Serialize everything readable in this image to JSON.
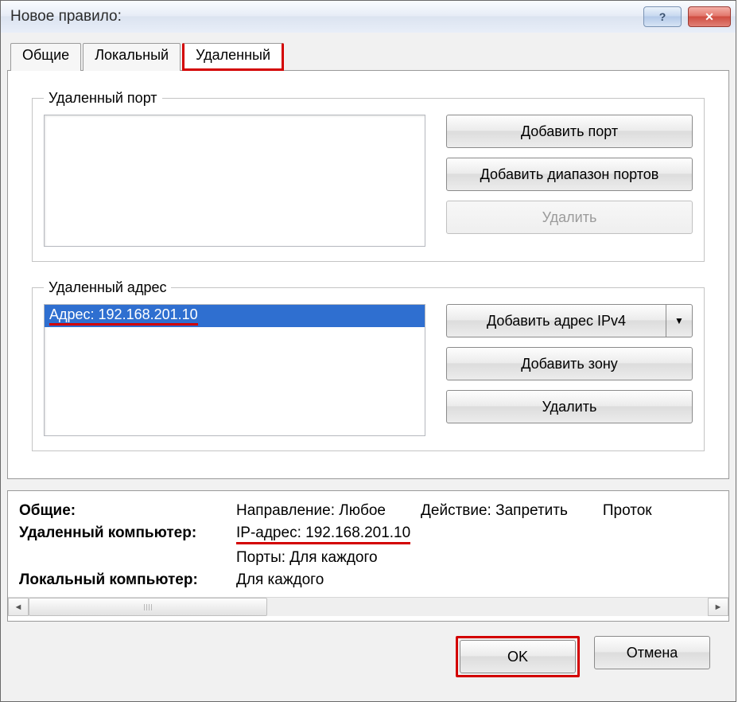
{
  "window": {
    "title": "Новое правило:"
  },
  "tabs": {
    "general": "Общие",
    "local": "Локальный",
    "remote": "Удаленный"
  },
  "remote_port": {
    "legend": "Удаленный порт",
    "add_port": "Добавить порт",
    "add_range": "Добавить диапазон портов",
    "delete": "Удалить"
  },
  "remote_addr": {
    "legend": "Удаленный адрес",
    "items": [
      "Адрес: 192.168.201.10"
    ],
    "add_ipv4": "Добавить адрес IPv4",
    "add_zone": "Добавить зону",
    "delete": "Удалить"
  },
  "summary": {
    "general_label": "Общие:",
    "direction_label": "Направление:",
    "direction_value": "Любое",
    "action_label": "Действие:",
    "action_value": "Запретить",
    "protocol_label": "Проток",
    "remote_pc_label": "Удаленный компьютер:",
    "remote_pc_ip": "IP-адрес: 192.168.201.10",
    "remote_pc_ports": "Порты: Для каждого",
    "local_pc_label": "Локальный компьютер:",
    "local_pc_value": "Для каждого"
  },
  "footer": {
    "ok": "OK",
    "cancel": "Отмена"
  },
  "icons": {
    "help": "?",
    "close": "✕",
    "down": "▼",
    "left": "◄",
    "right": "►"
  }
}
